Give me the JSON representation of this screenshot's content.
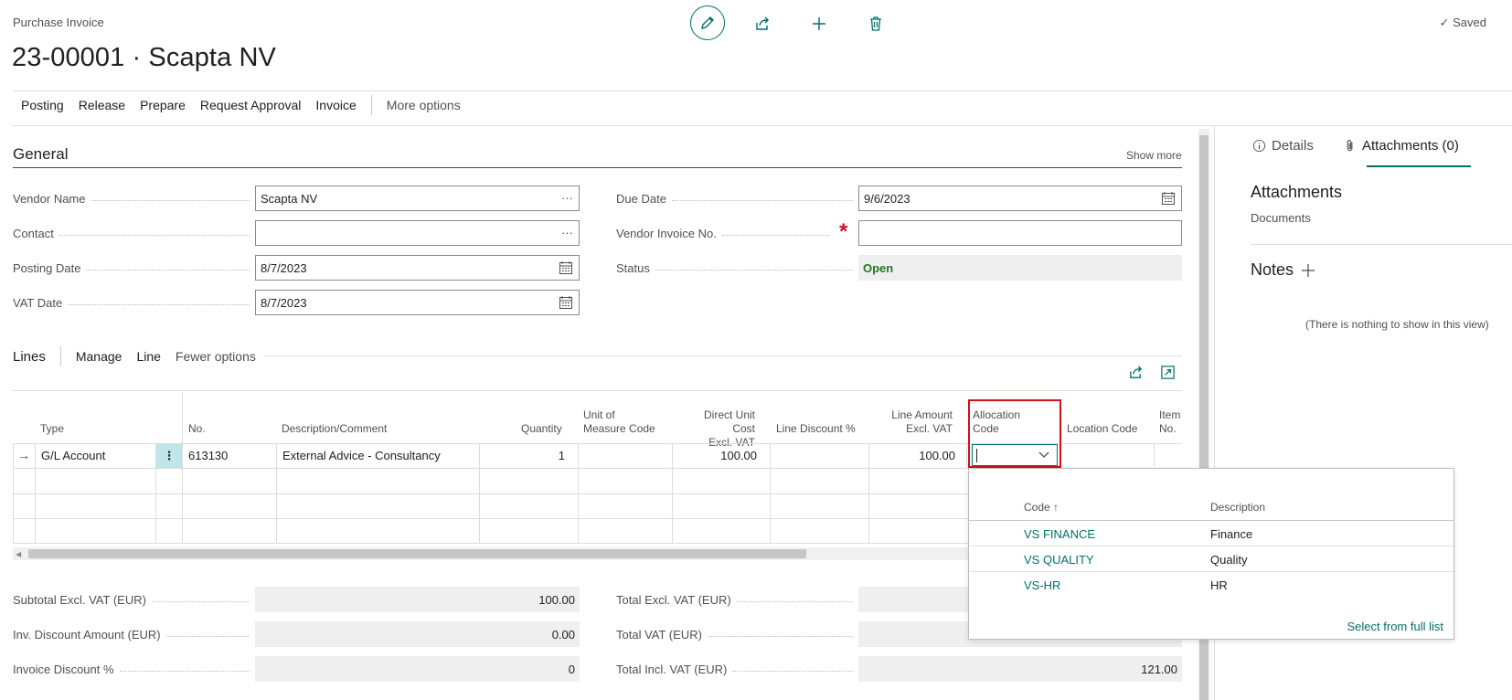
{
  "header": {
    "caption": "Purchase Invoice",
    "title": "23-00001 · Scapta NV",
    "saved": "Saved"
  },
  "actions": [
    "Posting",
    "Release",
    "Prepare",
    "Request Approval",
    "Invoice"
  ],
  "actions_more": "More options",
  "general": {
    "title": "General",
    "show_more": "Show more",
    "vendor_name_label": "Vendor Name",
    "vendor_name": "Scapta NV",
    "contact_label": "Contact",
    "contact": "",
    "posting_date_label": "Posting Date",
    "posting_date": "8/7/2023",
    "vat_date_label": "VAT Date",
    "vat_date": "8/7/2023",
    "due_date_label": "Due Date",
    "due_date": "9/6/2023",
    "vendor_invoice_no_label": "Vendor Invoice No.",
    "vendor_invoice_no": "",
    "status_label": "Status",
    "status": "Open"
  },
  "lines": {
    "title": "Lines",
    "manage": "Manage",
    "line": "Line",
    "fewer": "Fewer options",
    "columns": {
      "type": "Type",
      "no": "No.",
      "description": "Description/Comment",
      "quantity": "Quantity",
      "uom_1": "Unit of",
      "uom_2": "Measure Code",
      "ducost_1": "Direct Unit Cost",
      "ducost_2": "Excl. VAT",
      "discount": "Line Discount %",
      "amount_1": "Line Amount",
      "amount_2": "Excl. VAT",
      "alloc_1": "Allocation",
      "alloc_2": "Code",
      "location": "Location Code",
      "item_1": "Item",
      "item_2": "No."
    },
    "row": {
      "type": "G/L Account",
      "no": "613130",
      "description": "External Advice - Consultancy",
      "quantity": "1",
      "ducost": "100.00",
      "amount": "100.00"
    }
  },
  "dropdown": {
    "code_header": "Code",
    "desc_header": "Description",
    "items": [
      {
        "code": "VS FINANCE",
        "desc": "Finance"
      },
      {
        "code": "VS QUALITY",
        "desc": "Quality"
      },
      {
        "code": "VS-HR",
        "desc": "HR"
      }
    ],
    "select_full": "Select from full list"
  },
  "totals": {
    "subtotal_label": "Subtotal Excl. VAT (EUR)",
    "subtotal": "100.00",
    "inv_discount_label": "Inv. Discount Amount (EUR)",
    "inv_discount": "0.00",
    "inv_discount_pct_label": "Invoice Discount %",
    "inv_discount_pct": "0",
    "total_excl_label": "Total Excl. VAT (EUR)",
    "total_excl": "",
    "total_vat_label": "Total VAT (EUR)",
    "total_vat": "",
    "total_incl_label": "Total Incl. VAT (EUR)",
    "total_incl": "121.00"
  },
  "factbox": {
    "tab_details": "Details",
    "tab_attachments": "Attachments (0)",
    "attachments_title": "Attachments",
    "documents": "Documents",
    "notes_title": "Notes",
    "empty": "(There is nothing to show in this view)"
  },
  "colors": {
    "accent": "#00706a",
    "status_open": "#1f7a1f",
    "highlight": "#d0101a"
  }
}
